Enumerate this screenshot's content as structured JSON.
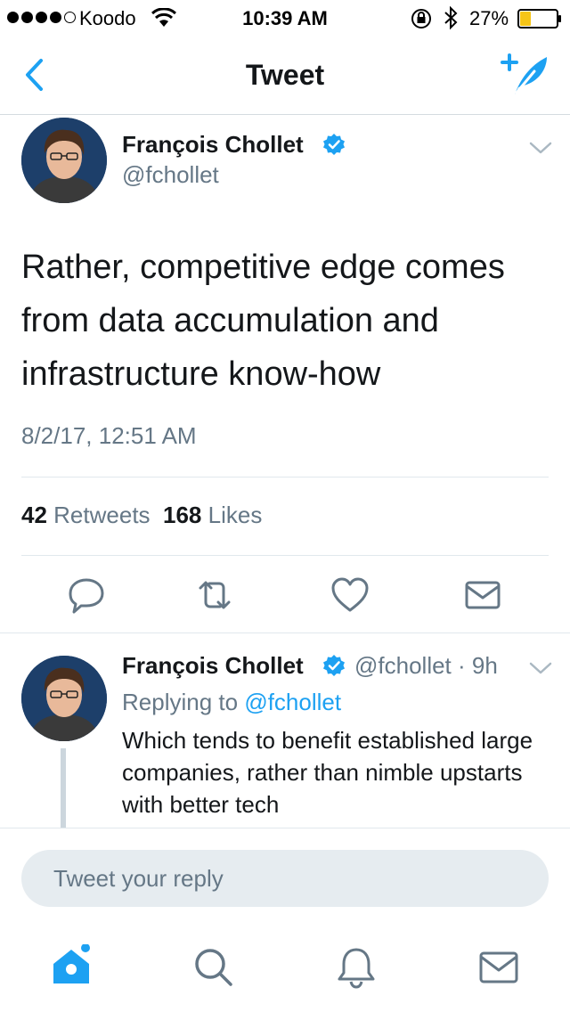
{
  "status_bar": {
    "carrier": "Koodo",
    "time": "10:39 AM",
    "battery": "27%"
  },
  "nav": {
    "title": "Tweet"
  },
  "tweet": {
    "author_name": "François Chollet",
    "author_handle": "@fchollet",
    "text": "Rather, competitive edge comes from data accumulation and infrastructure know-how",
    "timestamp": "8/2/17, 12:51 AM",
    "retweet_count": "42",
    "retweet_label": "Retweets",
    "like_count": "168",
    "like_label": "Likes"
  },
  "reply": {
    "author_name": "François Chollet",
    "meta": "@fchollet · 9h",
    "replying_prefix": "Replying to",
    "replying_to": "@fchollet",
    "text": "Which tends to benefit established large companies, rather than nimble upstarts with better tech"
  },
  "composer": {
    "placeholder": "Tweet your reply"
  },
  "icons": {
    "back": "chevron-left-icon",
    "compose": "compose-tweet-icon",
    "verified": "verified-badge-icon",
    "chevron": "chevron-down-icon",
    "reply": "reply-icon",
    "retweet": "retweet-icon",
    "like": "heart-icon",
    "dm": "envelope-icon",
    "home": "home-icon",
    "search": "search-icon",
    "notifications": "bell-icon",
    "messages": "envelope-icon"
  },
  "colors": {
    "accent": "#1da1f2",
    "secondary_text": "#657786",
    "primary_text": "#14171a",
    "battery_fill": "#f5c518"
  }
}
